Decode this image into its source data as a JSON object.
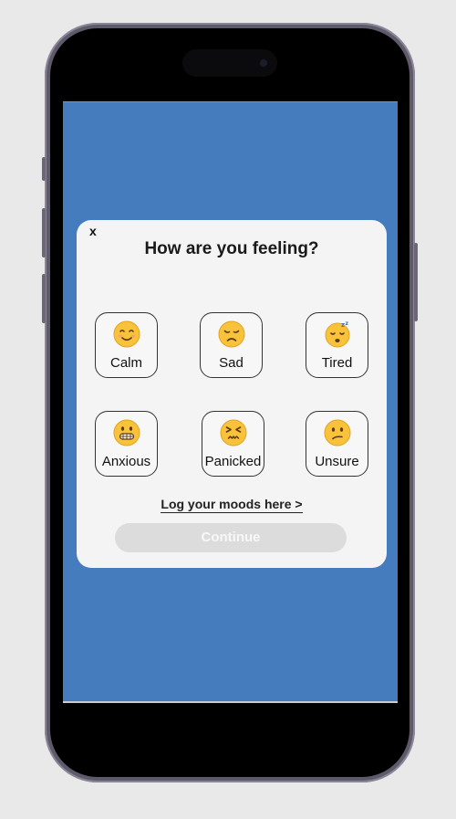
{
  "modal": {
    "close_label": "x",
    "title": "How are you feeling?",
    "moods": [
      {
        "label": "Calm",
        "icon": "smiling-face-icon"
      },
      {
        "label": "Sad",
        "icon": "disappointed-face-icon"
      },
      {
        "label": "Tired",
        "icon": "sleeping-face-icon"
      },
      {
        "label": "Anxious",
        "icon": "grimacing-face-icon"
      },
      {
        "label": "Panicked",
        "icon": "persevering-face-icon"
      },
      {
        "label": "Unsure",
        "icon": "confused-face-icon"
      }
    ],
    "log_link": "Log your moods here >",
    "continue_label": "Continue"
  },
  "colors": {
    "screen_background": "#447cbe",
    "modal_background": "#f4f4f4",
    "continue_disabled": "#dcdcdc",
    "emoji_yellow": "#f8c23a"
  }
}
